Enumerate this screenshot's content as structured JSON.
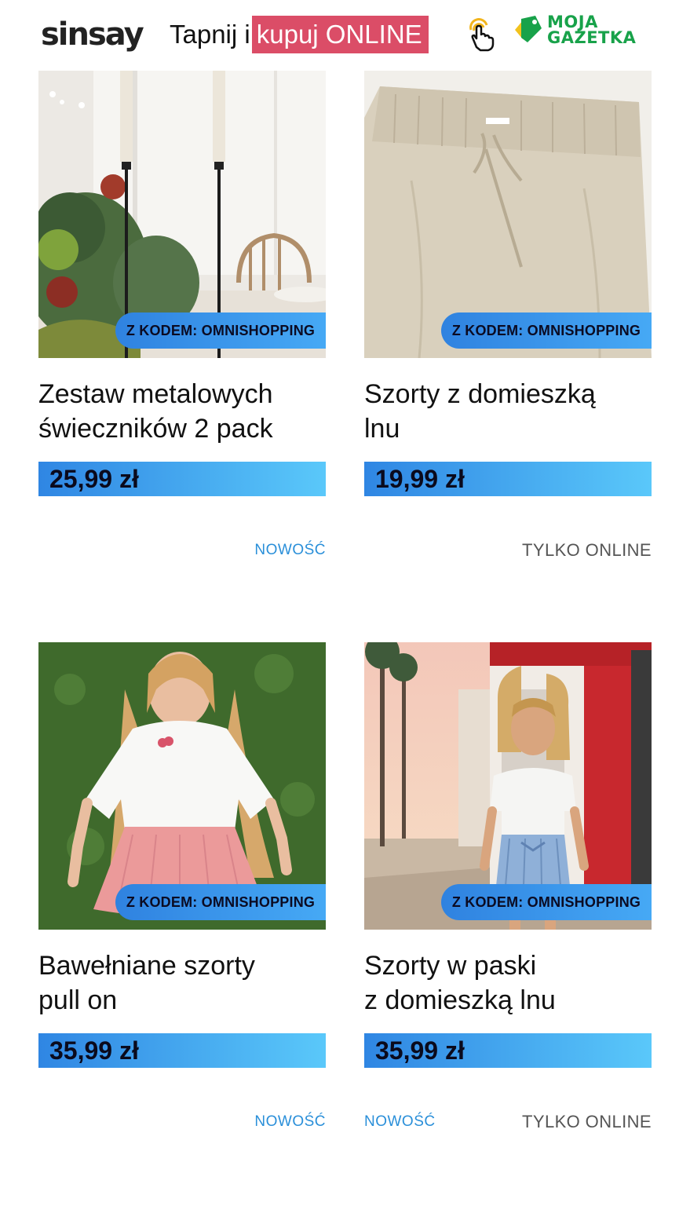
{
  "header": {
    "brand": "sinsay",
    "tagline_prefix": "Tapnij i",
    "tagline_highlight": "kupuj ONLINE",
    "hand_icon": "tap-hand-icon",
    "partner_line1": "MOJA",
    "partner_line2": "GAZETKA"
  },
  "colors": {
    "highlight": "#db4d67",
    "promo_blue": "#2f82e0",
    "new_tag": "#2a8fd9",
    "partner_green": "#18a24a"
  },
  "products": [
    {
      "promo": "Z KODEM: OMNISHOPPING",
      "title_line1": "Zestaw metalowych",
      "title_line2": "świeczników 2 pack",
      "price": "25,99 zł",
      "tag_new": "NOWOŚĆ",
      "tag_online": ""
    },
    {
      "promo": "Z KODEM: OMNISHOPPING",
      "title_line1": "Szorty z domieszką",
      "title_line2": "lnu",
      "price": "19,99 zł",
      "tag_new": "",
      "tag_online": "TYLKO ONLINE"
    },
    {
      "promo": "Z KODEM: OMNISHOPPING",
      "title_line1": "Bawełniane szorty",
      "title_line2": "pull on",
      "price": "35,99 zł",
      "tag_new": "NOWOŚĆ",
      "tag_online": ""
    },
    {
      "promo": "Z KODEM: OMNISHOPPING",
      "title_line1": "Szorty w paski",
      "title_line2": "z domieszką lnu",
      "price": "35,99 zł",
      "tag_new": "NOWOŚĆ",
      "tag_online": "TYLKO ONLINE"
    }
  ]
}
